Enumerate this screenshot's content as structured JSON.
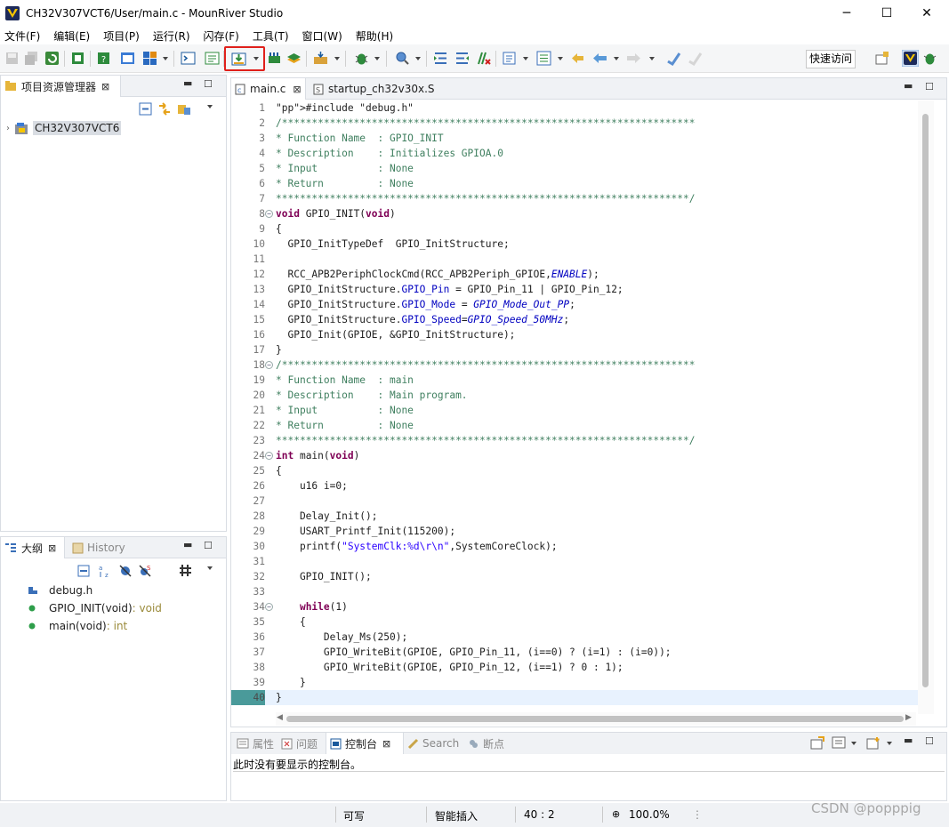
{
  "window": {
    "title": "CH32V307VCT6/User/main.c - MounRiver Studio",
    "minimize": "─",
    "maximize": "☐",
    "close": "✕"
  },
  "menu": [
    "文件(F)",
    "编辑(E)",
    "项目(P)",
    "运行(R)",
    "闪存(F)",
    "工具(T)",
    "窗口(W)",
    "帮助(H)"
  ],
  "toolbar": {
    "quick_access": "快速访问",
    "highlight_color": "#e0201b"
  },
  "project_explorer": {
    "tab": "项目资源管理器",
    "project": "CH32V307VCT6"
  },
  "outline": {
    "tabs": [
      "大纲",
      "History"
    ],
    "items": [
      {
        "name": "debug.h",
        "type": ""
      },
      {
        "name": "GPIO_INIT(void)",
        "type": " : void"
      },
      {
        "name": "main(void)",
        "type": " : int"
      }
    ]
  },
  "editor": {
    "tabs": [
      "main.c",
      "startup_ch32v30x.S"
    ],
    "cursor_line": 40,
    "lines": [
      "#include \"debug.h\"",
      "/*********************************************************************",
      "* Function Name  : GPIO_INIT",
      "* Description    : Initializes GPIOA.0",
      "* Input          : None",
      "* Return         : None",
      "*********************************************************************/",
      "void GPIO_INIT(void)",
      "{",
      "  GPIO_InitTypeDef  GPIO_InitStructure;",
      "",
      "  RCC_APB2PeriphClockCmd(RCC_APB2Periph_GPIOE,ENABLE);",
      "  GPIO_InitStructure.GPIO_Pin = GPIO_Pin_11 | GPIO_Pin_12;",
      "  GPIO_InitStructure.GPIO_Mode = GPIO_Mode_Out_PP;",
      "  GPIO_InitStructure.GPIO_Speed=GPIO_Speed_50MHz;",
      "  GPIO_Init(GPIOE, &GPIO_InitStructure);",
      "}",
      "/*********************************************************************",
      "* Function Name  : main",
      "* Description    : Main program.",
      "* Input          : None",
      "* Return         : None",
      "*********************************************************************/",
      "int main(void)",
      "{",
      "    u16 i=0;",
      "",
      "    Delay_Init();",
      "    USART_Printf_Init(115200);",
      "    printf(\"SystemClk:%d\\r\\n\",SystemCoreClock);",
      "",
      "    GPIO_INIT();",
      "",
      "    while(1)",
      "    {",
      "        Delay_Ms(250);",
      "        GPIO_WriteBit(GPIOE, GPIO_Pin_11, (i==0) ? (i=1) : (i=0));",
      "        GPIO_WriteBit(GPIOE, GPIO_Pin_12, (i==1) ? 0 : 1);",
      "    }",
      "}"
    ]
  },
  "console": {
    "tabs": [
      "属性",
      "问题",
      "控制台",
      "Search",
      "断点"
    ],
    "message": "此时没有要显示的控制台。"
  },
  "status": {
    "write_mode": "可写",
    "insert_mode": "智能插入",
    "position": "40 : 2",
    "zoom": "100.0%"
  },
  "watermark": "CSDN @popppig"
}
